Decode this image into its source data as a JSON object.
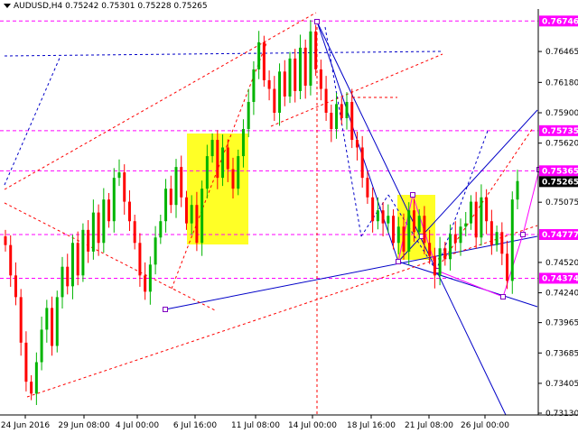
{
  "header": {
    "symbol": "AUDUSD,H4",
    "open": "0.75242",
    "high": "0.75301",
    "low": "0.75228",
    "close": "0.75265"
  },
  "chart_data": {
    "type": "candlestick",
    "ylim": [
      0.7313,
      0.7684
    ],
    "y_ticks": [
      "0.76465",
      "0.76180",
      "0.75900",
      "0.75620",
      "0.75075",
      "0.74520",
      "0.74240",
      "0.73965",
      "0.73685",
      "0.73405",
      "0.73130"
    ],
    "x_ticks": [
      "24 Jun 2016",
      "29 Jun 08:00",
      "4 Jul 00:00",
      "6 Jul 16:00",
      "11 Jul 08:00",
      "14 Jul 00:00",
      "18 Jul 16:00",
      "21 Jul 08:00",
      "26 Jul 00:00"
    ],
    "level_labels": [
      {
        "value": 0.76746,
        "text": "0.76746",
        "color": "#ff00ff"
      },
      {
        "value": 0.75735,
        "text": "0.75735",
        "color": "#ff00ff"
      },
      {
        "value": 0.75365,
        "text": "0.75365",
        "color": "#ff00ff"
      },
      {
        "value": 0.75265,
        "text": "0.75265",
        "color": "#000000"
      },
      {
        "value": 0.74777,
        "text": "0.74777",
        "color": "#ff00ff"
      },
      {
        "value": 0.74374,
        "text": "0.74374",
        "color": "#ff00ff"
      }
    ],
    "series": [
      {
        "values": [
          0.7468,
          0.744,
          0.742,
          0.7378,
          0.7342,
          0.7331,
          0.736,
          0.739,
          0.741,
          0.7375,
          0.742,
          0.7448,
          0.743,
          0.747,
          0.744,
          0.7482,
          0.7462,
          0.7498,
          0.747,
          0.751,
          0.749,
          0.753,
          0.7535,
          0.7508,
          0.749,
          0.747,
          0.744,
          0.7425,
          0.745,
          0.7475,
          0.749,
          0.752,
          0.7505,
          0.754,
          0.7512,
          0.7488,
          0.7505,
          0.747,
          0.752,
          0.755,
          0.7565,
          0.753,
          0.7558,
          0.7538,
          0.752,
          0.755,
          0.7575,
          0.76,
          0.763,
          0.7655,
          0.762,
          0.7612,
          0.759,
          0.7628,
          0.7605,
          0.764,
          0.761,
          0.765,
          0.7615,
          0.7665,
          0.763,
          0.7612,
          0.759,
          0.7575,
          0.7598,
          0.7585,
          0.76,
          0.7565,
          0.7558,
          0.753,
          0.7512,
          0.749,
          0.75,
          0.7488,
          0.7495,
          0.747,
          0.7485,
          0.7462,
          0.75,
          0.748,
          0.7495,
          0.747,
          0.7458,
          0.744,
          0.7465,
          0.7455,
          0.7478,
          0.747,
          0.7485,
          0.7488,
          0.7508,
          0.7475,
          0.7512,
          0.749,
          0.7468,
          0.748,
          0.746,
          0.7435,
          0.751,
          0.7527
        ]
      }
    ],
    "overlays": [
      {
        "type": "zone",
        "color": "#ffff00"
      },
      {
        "type": "zone",
        "color": "#ffff00"
      },
      {
        "type": "trendline",
        "color": "#0000c8"
      },
      {
        "type": "trendline",
        "color": "#ff00ff"
      },
      {
        "type": "trendline",
        "color": "#ff0000"
      }
    ],
    "grid": false
  }
}
